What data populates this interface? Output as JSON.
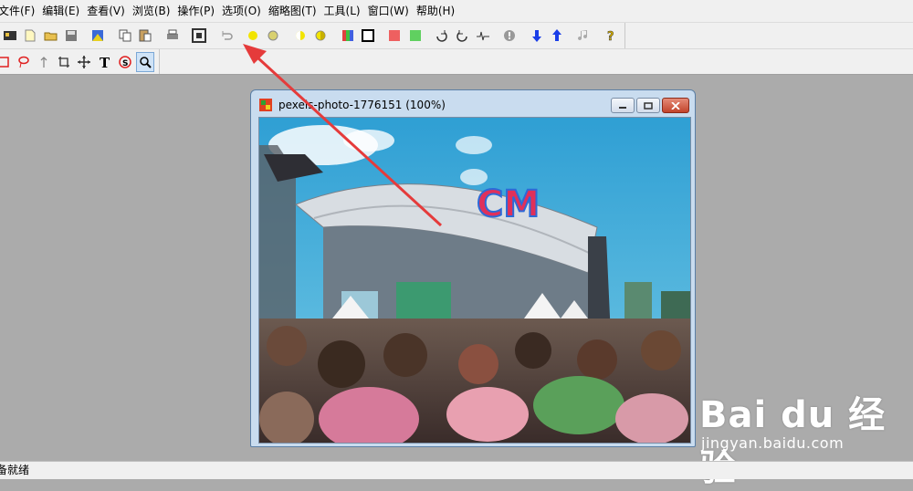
{
  "menu": [
    "文件(F)",
    "编辑(E)",
    "查看(V)",
    "浏览(B)",
    "操作(P)",
    "选项(O)",
    "缩略图(T)",
    "工具(L)",
    "窗口(W)",
    "帮助(H)"
  ],
  "toolbar_icons": [
    "scan-icon",
    "new-file-icon",
    "open-folder-icon",
    "save-icon",
    "paste-image-icon",
    "copy-icon",
    "paste-icon",
    "print-icon",
    "fit-to-screen-icon",
    "undo-icon",
    "brightness-icon",
    "brightness-alt-icon",
    "contrast-icon",
    "contrast-alt-icon",
    "color-balance-icon",
    "border-icon",
    "red-swatch-icon",
    "green-swatch-icon",
    "rotate-right-icon",
    "rotate-left-icon",
    "waveform-icon",
    "info-icon",
    "arrow-down-icon",
    "arrow-up-icon",
    "music-note-icon",
    "help-icon"
  ],
  "tools_icons": [
    "rectangle-select-icon",
    "lasso-icon",
    "arrow-tool-icon",
    "crop-icon",
    "move-icon",
    "text-tool-icon",
    "stamp-icon",
    "zoom-icon"
  ],
  "window": {
    "title": "pexels-photo-1776151 (100%)"
  },
  "photo": {
    "sign_text": "CM"
  },
  "status": {
    "text": "备就绪"
  },
  "watermark": {
    "main": "Bai du 经验",
    "sub": "jingyan.baidu.com"
  },
  "colors": {
    "accent_arrow": "#e53b3b",
    "window_border": "#5b7fa6",
    "sky": "#3aa6d6"
  }
}
